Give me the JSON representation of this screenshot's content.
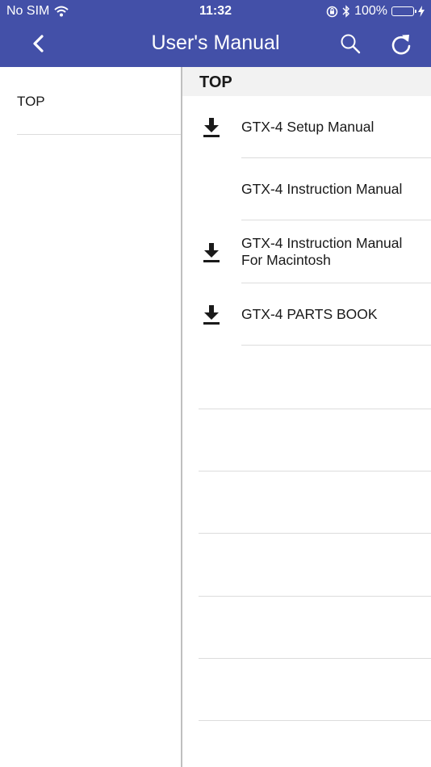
{
  "status_bar": {
    "carrier": "No SIM",
    "time": "11:32",
    "battery": "100%",
    "battery_level": 1.0,
    "battery_color": "#4cd964"
  },
  "nav": {
    "title": "User's Manual",
    "bar_color": "#4350a8",
    "icons": [
      "back-chevron-icon",
      "search-icon",
      "refresh-icon"
    ]
  },
  "sidebar": {
    "items": [
      {
        "label": "TOP"
      }
    ]
  },
  "content": {
    "section_title": "TOP",
    "items": [
      {
        "label": "GTX-4 Setup Manual",
        "download": true
      },
      {
        "label": "GTX-4 Instruction Manual",
        "download": false
      },
      {
        "label": "GTX-4 Instruction Manual For Macintosh",
        "download": true
      },
      {
        "label": "GTX-4 PARTS BOOK",
        "download": true
      }
    ]
  }
}
